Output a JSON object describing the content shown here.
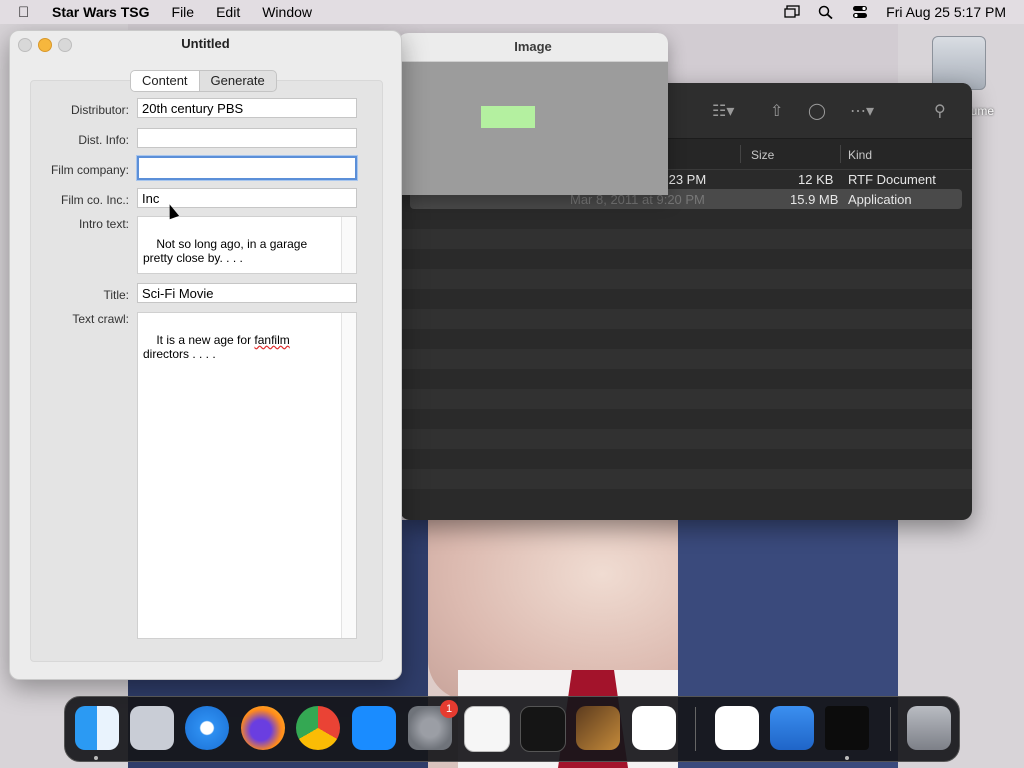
{
  "menubar": {
    "app_name": "Star Wars TSG",
    "items": [
      "File",
      "Edit",
      "Window"
    ],
    "clock": "Fri Aug 25  5:17 PM"
  },
  "desktop": {
    "drive_label": "lume"
  },
  "finder": {
    "columns": {
      "size": "Size",
      "kind": "Kind"
    },
    "rows": [
      {
        "date": ":23 PM",
        "size": "12 KB",
        "kind": "RTF Document"
      },
      {
        "date": "Mar 8, 2011 at 9:20 PM",
        "size": "15.9 MB",
        "kind": "Application"
      }
    ]
  },
  "image_window": {
    "title": "Image",
    "swatch_color": "#b4f0a0"
  },
  "main_window": {
    "title": "Untitled",
    "tabs": [
      "Content",
      "Generate"
    ],
    "fields": {
      "distributor": {
        "label": "Distributor:",
        "value": "20th century PBS"
      },
      "dist_info": {
        "label": "Dist. Info:",
        "value": ""
      },
      "film_company": {
        "label": "Film company:",
        "value": ""
      },
      "film_co_inc": {
        "label": "Film co. Inc.:",
        "value": "Inc"
      },
      "intro_text": {
        "label": "Intro text:",
        "value": "Not so long ago, in a garage pretty close by. . . ."
      },
      "title": {
        "label": "Title:",
        "value": "Sci-Fi Movie"
      },
      "text_crawl": {
        "label": "Text crawl:",
        "line1_pre": "It is a new age for ",
        "line1_word": "fanfilm",
        "line2": "directors . . . ."
      }
    }
  },
  "dock": {
    "apps": [
      "finder-icon",
      "launchpad-icon",
      "safari-icon",
      "firefox-icon",
      "chrome-icon",
      "app-store-icon",
      "system-settings-icon",
      "textedit-icon",
      "terminal-icon",
      "garageband-icon",
      "vscode-icon",
      "visual-studio-icon",
      "weather-icon",
      "star-wars-tsg-icon",
      "trash-icon"
    ],
    "system_settings_badge": "1"
  }
}
